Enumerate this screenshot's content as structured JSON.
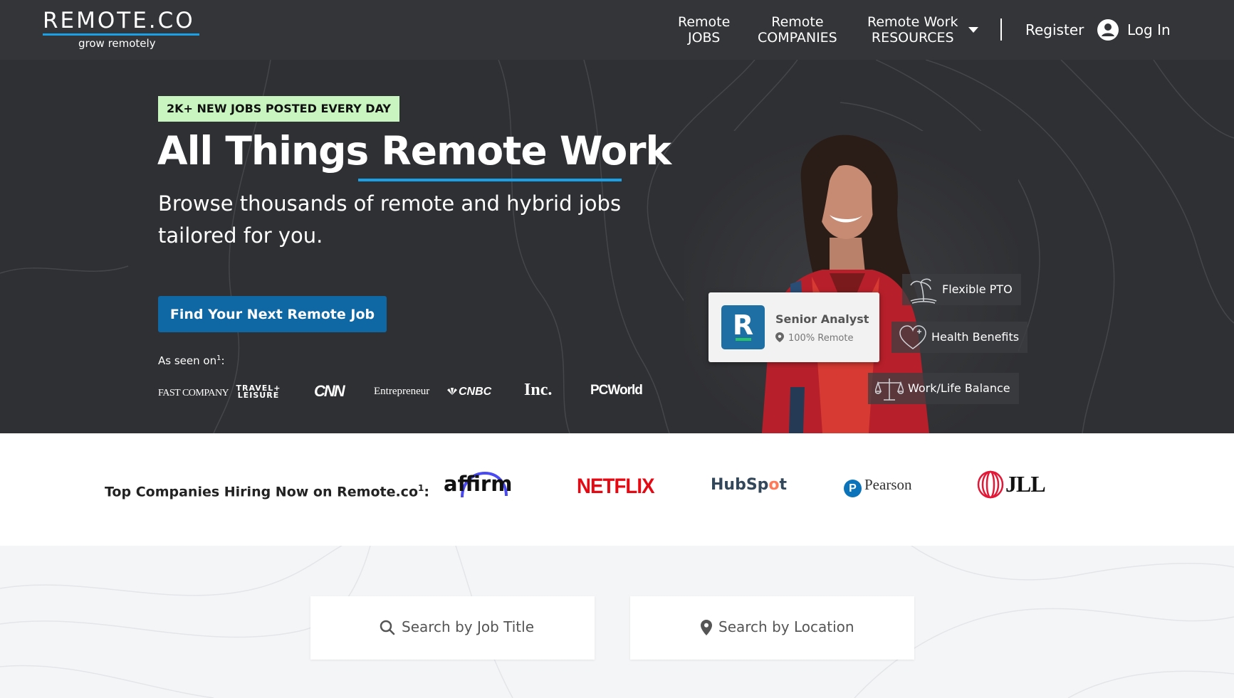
{
  "header": {
    "logo_text": "REMOTE.CO",
    "logo_tagline": "grow remotely",
    "nav": [
      {
        "line1": "Remote",
        "line2": "JOBS"
      },
      {
        "line1": "Remote",
        "line2": "COMPANIES"
      },
      {
        "line1": "Remote Work",
        "line2": "RESOURCES"
      }
    ],
    "register": "Register",
    "login": "Log In"
  },
  "hero": {
    "badge": "2K+ NEW JOBS POSTED EVERY DAY",
    "title": "All Things Remote Work",
    "subtitle": "Browse thousands of remote and hybrid jobs tailored for you.",
    "cta": "Find Your Next Remote Job",
    "seen_on": "As seen on",
    "seen_on_sup": "1",
    "seen_on_suffix": ":",
    "press": [
      "FAST COMPANY",
      "TRAVEL+ LEISURE",
      "CNN",
      "Entrepreneur",
      "CNBC",
      "Inc.",
      "PCWorld"
    ],
    "job_card": {
      "logo_letter": "R",
      "title": "Senior Analyst",
      "location": "100% Remote"
    },
    "benefits": [
      "Flexible PTO",
      "Health Benefits",
      "Work/Life Balance"
    ]
  },
  "companies": {
    "label": "Top Companies Hiring Now on Remote.co",
    "label_sup": "1",
    "label_suffix": ":",
    "logos": [
      "affirm",
      "NETFLIX",
      "HubSpot",
      "Pearson",
      "JLL"
    ]
  },
  "search": {
    "job_title_placeholder": "Search by Job Title",
    "location_placeholder": "Search by Location"
  },
  "colors": {
    "header_bg": "#333538",
    "hero_bg": "#2f3033",
    "accent_blue": "#1aa0e6",
    "cta_blue": "#0f67a3",
    "badge_green": "#c8f5c0",
    "netflix_red": "#e50914"
  }
}
